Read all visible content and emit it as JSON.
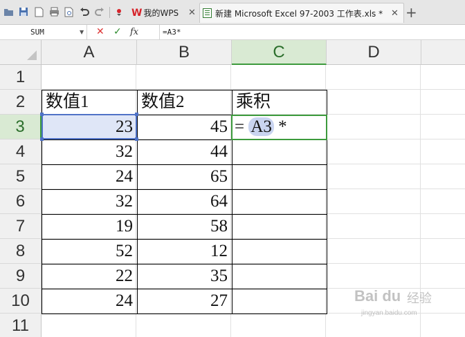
{
  "tabs": [
    {
      "label": "我的WPS",
      "active": false
    },
    {
      "label": "新建 Microsoft Excel 97-2003 工作表.xls *",
      "active": true
    }
  ],
  "formula_bar": {
    "name_box": "SUM",
    "fx_label": "fx",
    "formula": "=A3*"
  },
  "columns": [
    "A",
    "B",
    "C",
    "D"
  ],
  "active_column": "C",
  "rows": [
    "1",
    "2",
    "3",
    "4",
    "5",
    "6",
    "7",
    "8",
    "9",
    "10",
    "11"
  ],
  "active_row": "3",
  "table": {
    "headers": [
      "数值1",
      "数值2",
      "乘积"
    ],
    "rows": [
      [
        "23",
        "45"
      ],
      [
        "32",
        "44"
      ],
      [
        "24",
        "65"
      ],
      [
        "32",
        "64"
      ],
      [
        "19",
        "58"
      ],
      [
        "52",
        "12"
      ],
      [
        "22",
        "35"
      ],
      [
        "24",
        "27"
      ]
    ]
  },
  "editing_cell": {
    "eq": "=",
    "ref": "A3",
    "op": "*"
  },
  "watermark": {
    "logo": "Bai du",
    "text": "经验",
    "url": "jingyan.baidu.com"
  },
  "colors": {
    "active_green": "#3c9a3c",
    "ref_blue": "#4f72c7",
    "wps_red": "#d6232a"
  }
}
